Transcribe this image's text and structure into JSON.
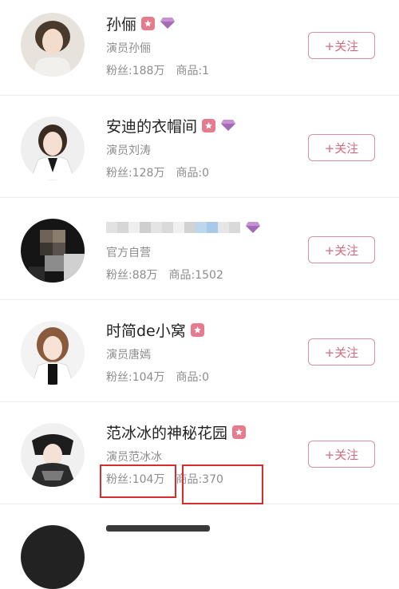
{
  "follow_label": "+关注",
  "rows": [
    {
      "name": "孙俪",
      "subtitle": "演员孙俪",
      "fans": "粉丝:188万",
      "goods": "商品:1"
    },
    {
      "name": "安迪的衣帽间",
      "subtitle": "演员刘涛",
      "fans": "粉丝:128万",
      "goods": "商品:0"
    },
    {
      "name": "",
      "subtitle": "官方自营",
      "fans": "粉丝:88万",
      "goods": "商品:1502"
    },
    {
      "name": "时简de小窝",
      "subtitle": "演员唐嫣",
      "fans": "粉丝:104万",
      "goods": "商品:0"
    },
    {
      "name": "范冰冰的神秘花园",
      "subtitle": "演员范冰冰",
      "fans": "粉丝:104万",
      "goods": "商品:370"
    },
    {
      "name": "",
      "subtitle": "",
      "fans": "",
      "goods": ""
    }
  ],
  "colors": {
    "accent": "#d06b7e",
    "badge": "#e57b8d",
    "gem": "#a36bb5",
    "highlight": "#d92c2c"
  },
  "icons": {
    "badge": "star-badge-icon",
    "gem": "diamond-icon"
  }
}
